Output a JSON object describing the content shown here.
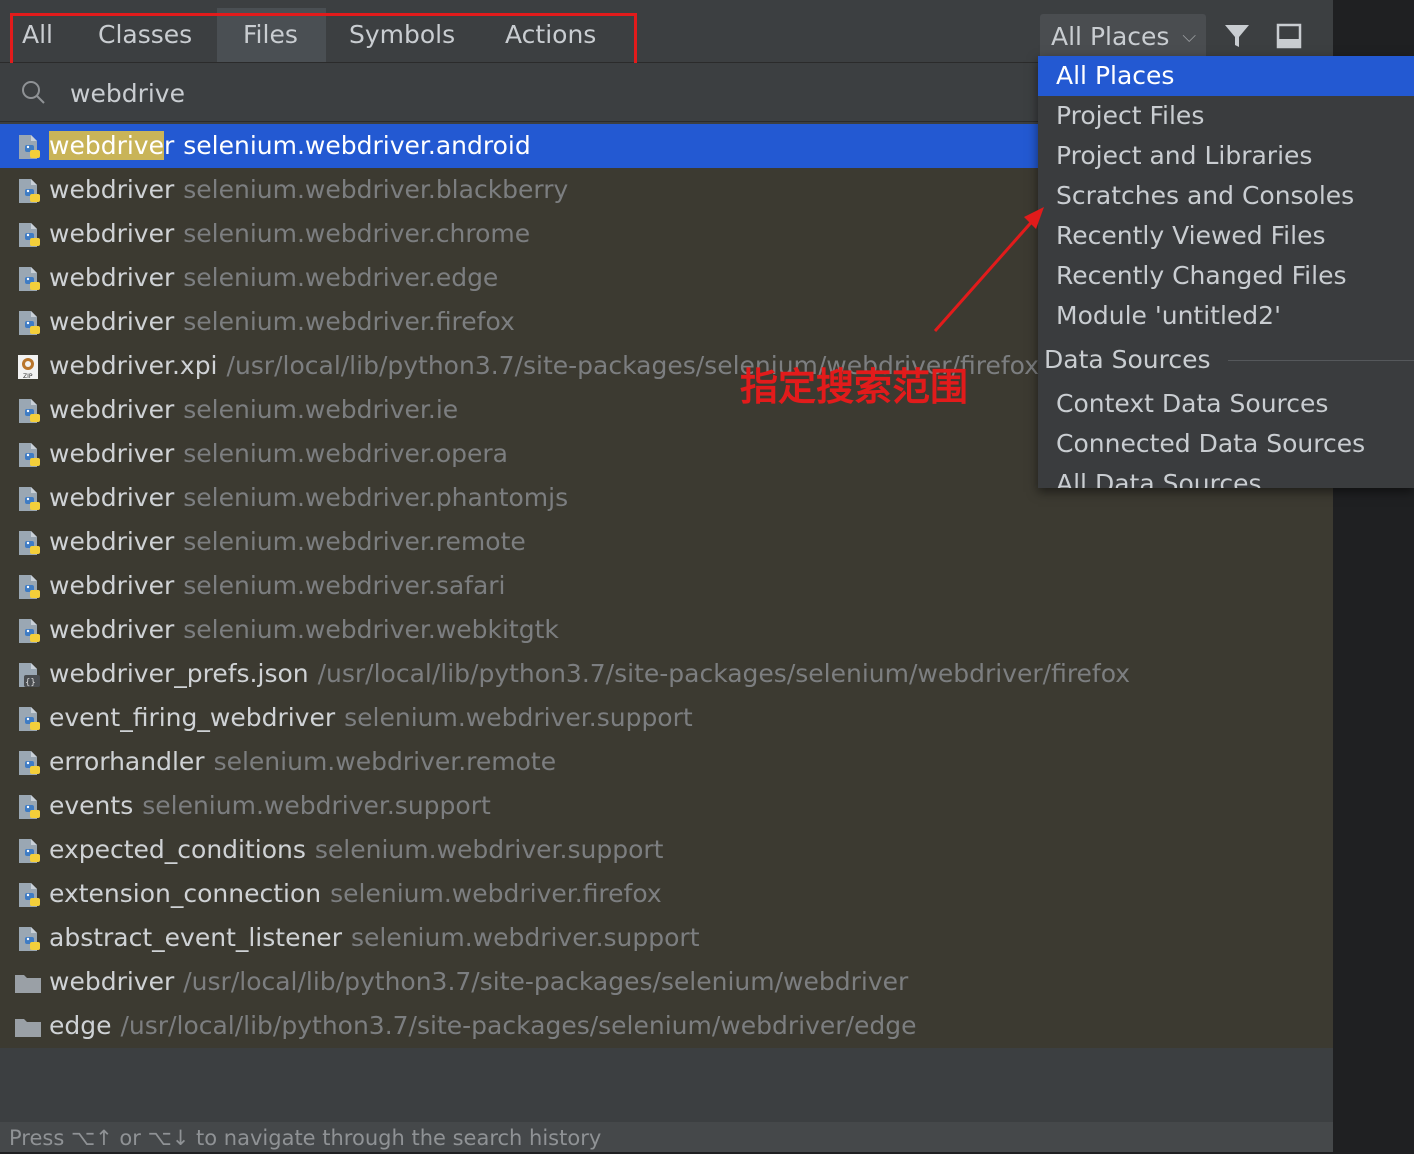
{
  "tabs": [
    {
      "label": "All"
    },
    {
      "label": "Classes"
    },
    {
      "label": "Files"
    },
    {
      "label": "Symbols"
    },
    {
      "label": "Actions"
    }
  ],
  "scope": {
    "label": "All Places"
  },
  "search": {
    "value": "webdrive"
  },
  "results": [
    {
      "highlight": "webdrive",
      "rest": "r",
      "location": "selenium.webdriver.android",
      "icon": "python-package-icon"
    },
    {
      "highlight": "",
      "rest": "webdriver",
      "location": "selenium.webdriver.blackberry",
      "icon": "python-package-icon"
    },
    {
      "highlight": "",
      "rest": "webdriver",
      "location": "selenium.webdriver.chrome",
      "icon": "python-package-icon"
    },
    {
      "highlight": "",
      "rest": "webdriver",
      "location": "selenium.webdriver.edge",
      "icon": "python-package-icon"
    },
    {
      "highlight": "",
      "rest": "webdriver",
      "location": "selenium.webdriver.firefox",
      "icon": "python-package-icon"
    },
    {
      "highlight": "",
      "rest": "webdriver.xpi",
      "location": "/usr/local/lib/python3.7/site-packages/selenium/webdriver/firefox",
      "icon": "zip-file-icon"
    },
    {
      "highlight": "",
      "rest": "webdriver",
      "location": "selenium.webdriver.ie",
      "icon": "python-package-icon"
    },
    {
      "highlight": "",
      "rest": "webdriver",
      "location": "selenium.webdriver.opera",
      "icon": "python-package-icon"
    },
    {
      "highlight": "",
      "rest": "webdriver",
      "location": "selenium.webdriver.phantomjs",
      "icon": "python-package-icon"
    },
    {
      "highlight": "",
      "rest": "webdriver",
      "location": "selenium.webdriver.remote",
      "icon": "python-package-icon"
    },
    {
      "highlight": "",
      "rest": "webdriver",
      "location": "selenium.webdriver.safari",
      "icon": "python-package-icon"
    },
    {
      "highlight": "",
      "rest": "webdriver",
      "location": "selenium.webdriver.webkitgtk",
      "icon": "python-package-icon"
    },
    {
      "highlight": "",
      "rest": "webdriver_prefs.json",
      "location": "/usr/local/lib/python3.7/site-packages/selenium/webdriver/firefox",
      "icon": "json-file-icon"
    },
    {
      "highlight": "",
      "rest": "event_firing_webdriver",
      "location": "selenium.webdriver.support",
      "icon": "python-package-icon"
    },
    {
      "highlight": "",
      "rest": "errorhandler",
      "location": "selenium.webdriver.remote",
      "icon": "python-package-icon"
    },
    {
      "highlight": "",
      "rest": "events",
      "location": "selenium.webdriver.support",
      "icon": "python-package-icon"
    },
    {
      "highlight": "",
      "rest": "expected_conditions",
      "location": "selenium.webdriver.support",
      "icon": "python-package-icon"
    },
    {
      "highlight": "",
      "rest": "extension_connection",
      "location": "selenium.webdriver.firefox",
      "icon": "python-package-icon"
    },
    {
      "highlight": "",
      "rest": "abstract_event_listener",
      "location": "selenium.webdriver.support",
      "icon": "python-package-icon"
    },
    {
      "highlight": "",
      "rest": "webdriver",
      "location": "/usr/local/lib/python3.7/site-packages/selenium/webdriver",
      "icon": "folder-icon"
    },
    {
      "highlight": "",
      "rest": "edge",
      "location": "/usr/local/lib/python3.7/site-packages/selenium/webdriver/edge",
      "icon": "folder-icon"
    }
  ],
  "dropdown": {
    "items": [
      "All Places",
      "Project Files",
      "Project and Libraries",
      "Scratches and Consoles",
      "Recently Viewed Files",
      "Recently Changed Files",
      "Module 'untitled2'"
    ],
    "section_label": "Data Sources",
    "section_items": [
      "Context Data Sources",
      "Connected Data Sources",
      "All Data Sources"
    ]
  },
  "annotation": {
    "text": "指定搜索范围"
  },
  "status": {
    "text": "Press ⌥↑ or ⌥↓ to navigate through the search history"
  },
  "colors": {
    "selection": "#2359d2",
    "highlight": "#c9b458",
    "annotation": "#e21b1b"
  }
}
